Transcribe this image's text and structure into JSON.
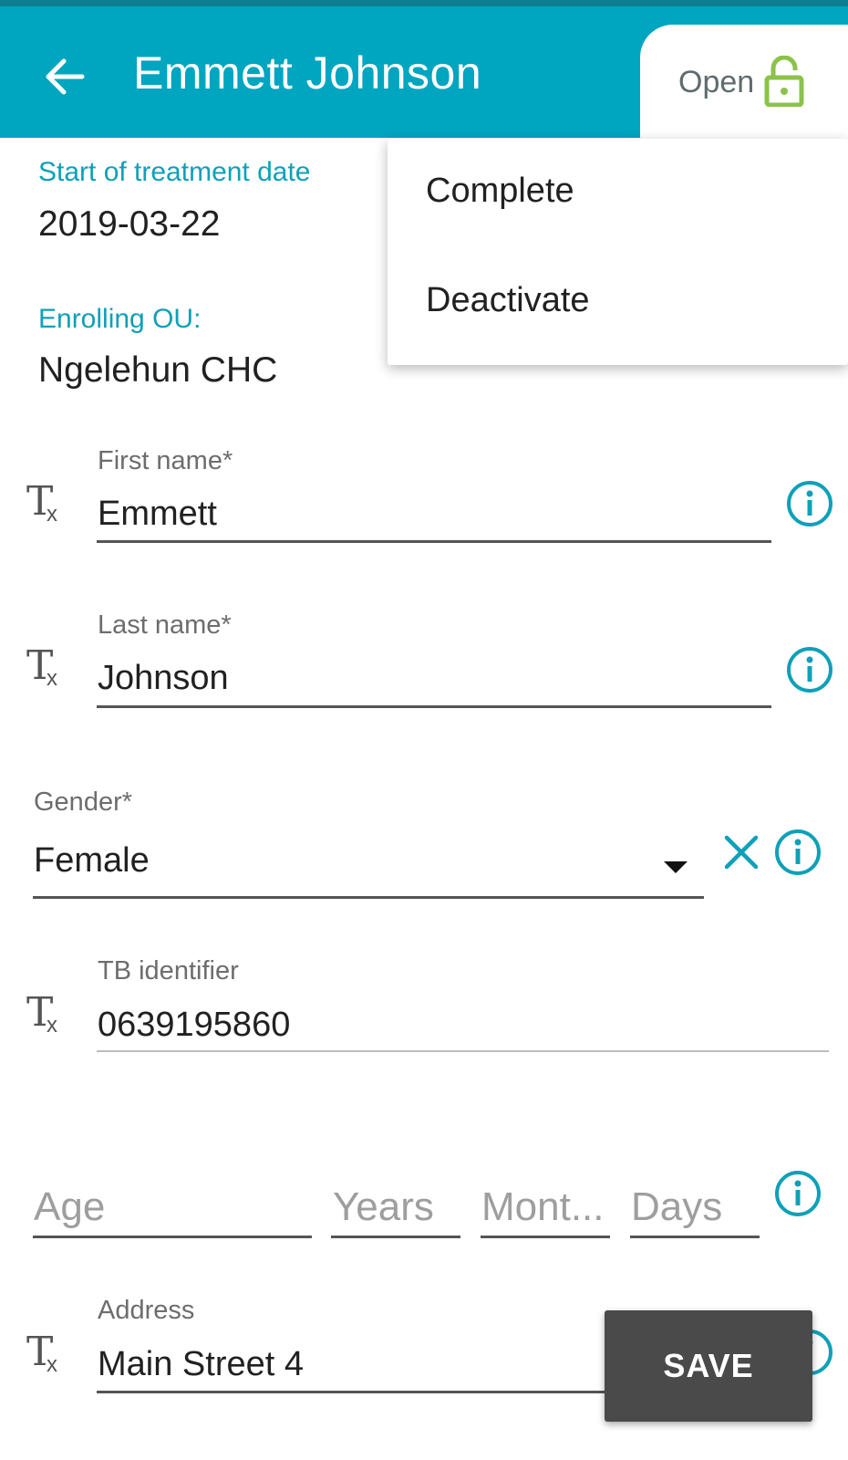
{
  "header": {
    "title": "Emmett Johnson",
    "status_label": "Open"
  },
  "menu": {
    "items": [
      "Complete",
      "Deactivate"
    ]
  },
  "enrollment": {
    "start_date_label": "Start of treatment date",
    "start_date_value": "2019-03-22",
    "ou_label": "Enrolling OU:",
    "ou_value": "Ngelehun CHC"
  },
  "form": {
    "first_name": {
      "label": "First name*",
      "value": "Emmett"
    },
    "last_name": {
      "label": "Last name*",
      "value": "Johnson"
    },
    "gender": {
      "label": "Gender*",
      "value": "Female"
    },
    "tb_identifier": {
      "label": "TB identifier",
      "value": "0639195860"
    },
    "age": {
      "placeholder": "Age",
      "years": "Years",
      "months": "Mont...",
      "days": "Days"
    },
    "address": {
      "label": "Address",
      "value": "Main Street 4"
    }
  },
  "actions": {
    "save_label": "SAVE"
  },
  "colors": {
    "appbar": "#00a5bf",
    "accent": "#0fa0b8",
    "lock_green": "#8bc34a",
    "save_button": "#4a4a4a"
  },
  "icons": [
    "back-arrow-icon",
    "lock-open-icon",
    "text-field-icon",
    "info-icon",
    "clear-icon",
    "dropdown-arrow-icon"
  ]
}
